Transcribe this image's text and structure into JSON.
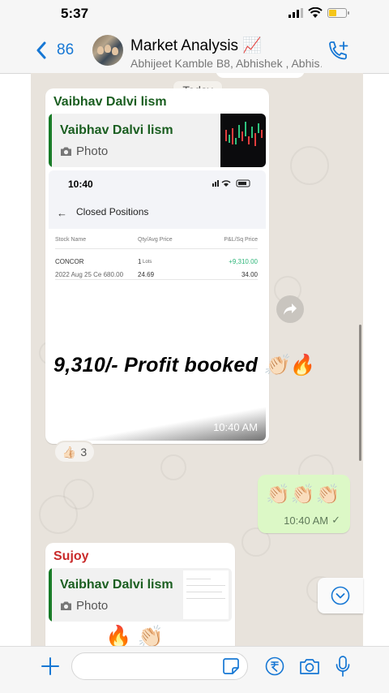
{
  "status_bar": {
    "time": "5:37"
  },
  "header": {
    "back_count": "86",
    "title": "Market Analysis 📈",
    "subtitle": "Abhijeet Kamble B8, Abhishek , Abhis…"
  },
  "chat": {
    "date_chip": "Today",
    "message1": {
      "sender": "Vaibhav Dalvi lism",
      "quote_name": "Vaibhav Dalvi lism",
      "quote_type": "Photo",
      "screenshot": {
        "time": "10:40",
        "title": "Closed Positions",
        "columns": [
          "Stock Name",
          "Qty/Avg Price",
          "P&L/Sq Price"
        ],
        "row": {
          "stock": "CONCOR",
          "contract": "2022 Aug 25 Ce 680.00",
          "qty": "1",
          "qty_unit": "Lots",
          "avg_price": "24.69",
          "pnl": "+9,310.00",
          "sq_price": "34.00"
        }
      },
      "overlay_text": "9,310/- Profit booked 👏🏻🔥",
      "timestamp": "10:40 AM",
      "reaction": {
        "emoji": "👍🏻",
        "count": "3"
      }
    },
    "message2": {
      "text": "👏🏻👏🏻👏🏻",
      "timestamp": "10:40 AM",
      "tick": "✓"
    },
    "message3": {
      "sender": "Sujoy",
      "quote_name": "Vaibhav Dalvi lism",
      "quote_type": "Photo",
      "emoji": "🔥 👏🏻"
    }
  },
  "input": {
    "placeholder": ""
  },
  "colors": {
    "accent": "#1677d4",
    "outgoing_bubble": "#dcf8c6",
    "chat_bg": "#e8e3dc",
    "profit_green": "#2fb67a"
  }
}
